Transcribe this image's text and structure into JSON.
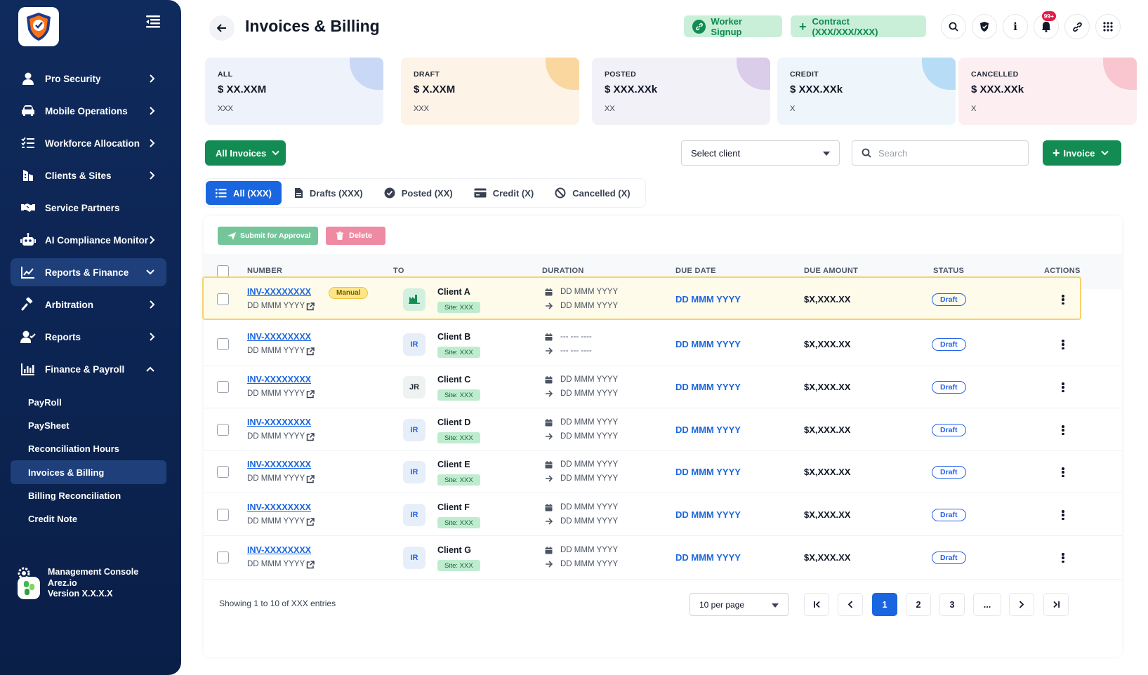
{
  "sidebar": {
    "nav": [
      {
        "label": "Pro Security",
        "icon": "user-icon",
        "chevron": "right"
      },
      {
        "label": "Mobile Operations",
        "icon": "car-icon",
        "chevron": "right"
      },
      {
        "label": "Workforce Allocation",
        "icon": "list-check-icon",
        "chevron": "right"
      },
      {
        "label": "Clients & Sites",
        "icon": "building-icon",
        "chevron": "right"
      },
      {
        "label": "Service Partners",
        "icon": "handshake-icon",
        "chevron": "none"
      },
      {
        "label": "AI Compliance Monitor",
        "icon": "robot-icon",
        "chevron": "right"
      },
      {
        "label": "Reports & Finance",
        "icon": "chart-line-icon",
        "chevron": "down"
      },
      {
        "label": "Arbitration",
        "icon": "gavel-icon",
        "chevron": "right"
      },
      {
        "label": "Reports",
        "icon": "user-check-icon",
        "chevron": "right"
      },
      {
        "label": "Finance & Payroll",
        "icon": "bar-chart-icon",
        "chevron": "up"
      }
    ],
    "sub": [
      "PayRoll",
      "PaySheet",
      "Reconciliation Hours",
      "Invoices & Billing",
      "Billing Reconciliation",
      "Credit Note"
    ],
    "console": {
      "line1": "Management Console",
      "line2": "Arez.io",
      "line3": "Version X.X.X.X"
    }
  },
  "header": {
    "title": "Invoices & Billing",
    "worker_signup": "Worker Signup",
    "contract": "Contract (XXX/XXX/XXX)",
    "notif_badge": "99+"
  },
  "cards": [
    {
      "label": "ALL",
      "value": "$ XX.XXM",
      "count": "XXX",
      "bg": "#eef3fb",
      "accent": "#c8d8f5"
    },
    {
      "label": "DRAFT",
      "value": "$ X.XXM",
      "count": "XXX",
      "bg": "#fdf3e6",
      "accent": "#fbd7a0"
    },
    {
      "label": "POSTED",
      "value": "$ XXX.XXk",
      "count": "XX",
      "bg": "#f3f1f8",
      "accent": "#d9cdea"
    },
    {
      "label": "CREDIT",
      "value": "$ XXX.XXk",
      "count": "X",
      "bg": "#eef6fc",
      "accent": "#b7dcf6"
    },
    {
      "label": "CANCELLED",
      "value": "$ XXX.XXk",
      "count": "X",
      "bg": "#fdeff1",
      "accent": "#f9c6cf"
    }
  ],
  "filters": {
    "all_invoices": "All Invoices",
    "select_client": "Select client",
    "search_placeholder": "Search",
    "invoice_btn": "Invoice"
  },
  "tabs": [
    {
      "label": "All (XXX)",
      "icon": "list-icon",
      "active": true
    },
    {
      "label": "Drafts (XXX)",
      "icon": "document-icon",
      "active": false
    },
    {
      "label": "Posted (XX)",
      "icon": "check-circle-icon",
      "active": false
    },
    {
      "label": "Credit (X)",
      "icon": "credit-card-icon",
      "active": false
    },
    {
      "label": "Cancelled (X)",
      "icon": "ban-icon",
      "active": false
    }
  ],
  "bulk": {
    "submit": "Submit for Approval",
    "delete": "Delete"
  },
  "table": {
    "columns": [
      "NUMBER",
      "TO",
      "DURATION",
      "DUE DATE",
      "DUE AMOUNT",
      "STATUS",
      "ACTIONS"
    ],
    "rows": [
      {
        "number": "INV-XXXXXXXX",
        "date": "DD MMM YYYY",
        "manual": "Manual",
        "avatar": "",
        "client": "Client A",
        "site": "Site: XXX",
        "from": "DD MMM YYYY",
        "to": "DD MMM YYYY",
        "due": "DD MMM YYYY",
        "amount": "$X,XXX.XX",
        "status": "Draft"
      },
      {
        "number": "INV-XXXXXXXX",
        "date": "DD MMM YYYY",
        "manual": "",
        "avatar": "IR",
        "client": "Client B",
        "site": "Site: XXX",
        "from": "--- --- ----",
        "to": "--- --- ----",
        "due": "DD MMM YYYY",
        "amount": "$X,XXX.XX",
        "status": "Draft"
      },
      {
        "number": "INV-XXXXXXXX",
        "date": "DD MMM YYYY",
        "manual": "",
        "avatar": "JR",
        "client": "Client C",
        "site": "Site: XXX",
        "from": "DD MMM YYYY",
        "to": "DD MMM YYYY",
        "due": "DD MMM YYYY",
        "amount": "$X,XXX.XX",
        "status": "Draft"
      },
      {
        "number": "INV-XXXXXXXX",
        "date": "DD MMM YYYY",
        "manual": "",
        "avatar": "IR",
        "client": "Client D",
        "site": "Site: XXX",
        "from": "DD MMM YYYY",
        "to": "DD MMM YYYY",
        "due": "DD MMM YYYY",
        "amount": "$X,XXX.XX",
        "status": "Draft"
      },
      {
        "number": "INV-XXXXXXXX",
        "date": "DD MMM YYYY",
        "manual": "",
        "avatar": "IR",
        "client": "Client E",
        "site": "Site: XXX",
        "from": "DD MMM YYYY",
        "to": "DD MMM YYYY",
        "due": "DD MMM YYYY",
        "amount": "$X,XXX.XX",
        "status": "Draft"
      },
      {
        "number": "INV-XXXXXXXX",
        "date": "DD MMM YYYY",
        "manual": "",
        "avatar": "IR",
        "client": "Client F",
        "site": "Site: XXX",
        "from": "DD MMM YYYY",
        "to": "DD MMM YYYY",
        "due": "DD MMM YYYY",
        "amount": "$X,XXX.XX",
        "status": "Draft"
      },
      {
        "number": "INV-XXXXXXXX",
        "date": "DD MMM YYYY",
        "manual": "",
        "avatar": "IR",
        "client": "Client G",
        "site": "Site: XXX",
        "from": "DD MMM YYYY",
        "to": "DD MMM YYYY",
        "due": "DD MMM YYYY",
        "amount": "$X,XXX.XX",
        "status": "Draft"
      }
    ]
  },
  "footer": {
    "showing": "Showing 1 to 10 of XXX entries",
    "per_page": "10 per page",
    "pages": [
      "1",
      "2",
      "3",
      "..."
    ]
  },
  "colors": {
    "primary": "#1a66e0",
    "success": "#128c52",
    "sidebar": "#0f2a5c"
  }
}
